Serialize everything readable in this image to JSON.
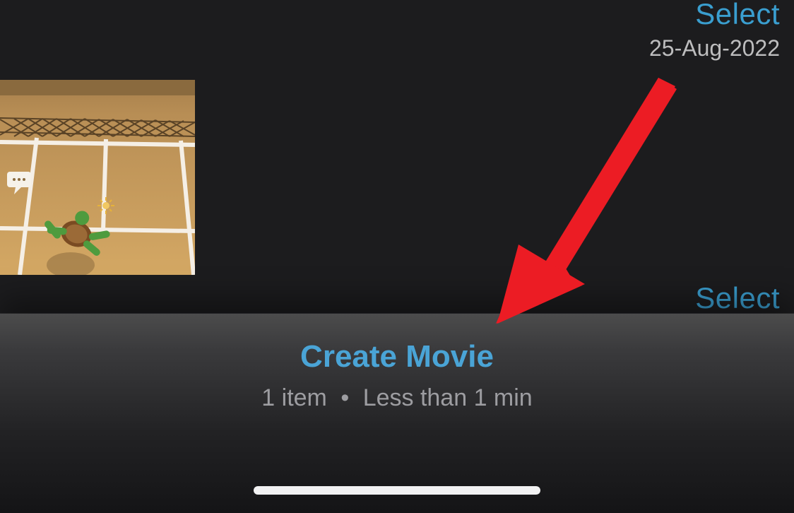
{
  "header": {
    "select_label": "Select",
    "date_label": "25-Aug-2022"
  },
  "grid": {
    "items": [
      {
        "name": "tennis-court-video-thumbnail"
      }
    ]
  },
  "section2": {
    "select_label": "Select"
  },
  "panel": {
    "action_label": "Create Movie",
    "item_count_label": "1 item",
    "separator": "•",
    "duration_label": "Less than 1 min"
  },
  "annotation": {
    "arrow_color": "#ec1c24"
  }
}
